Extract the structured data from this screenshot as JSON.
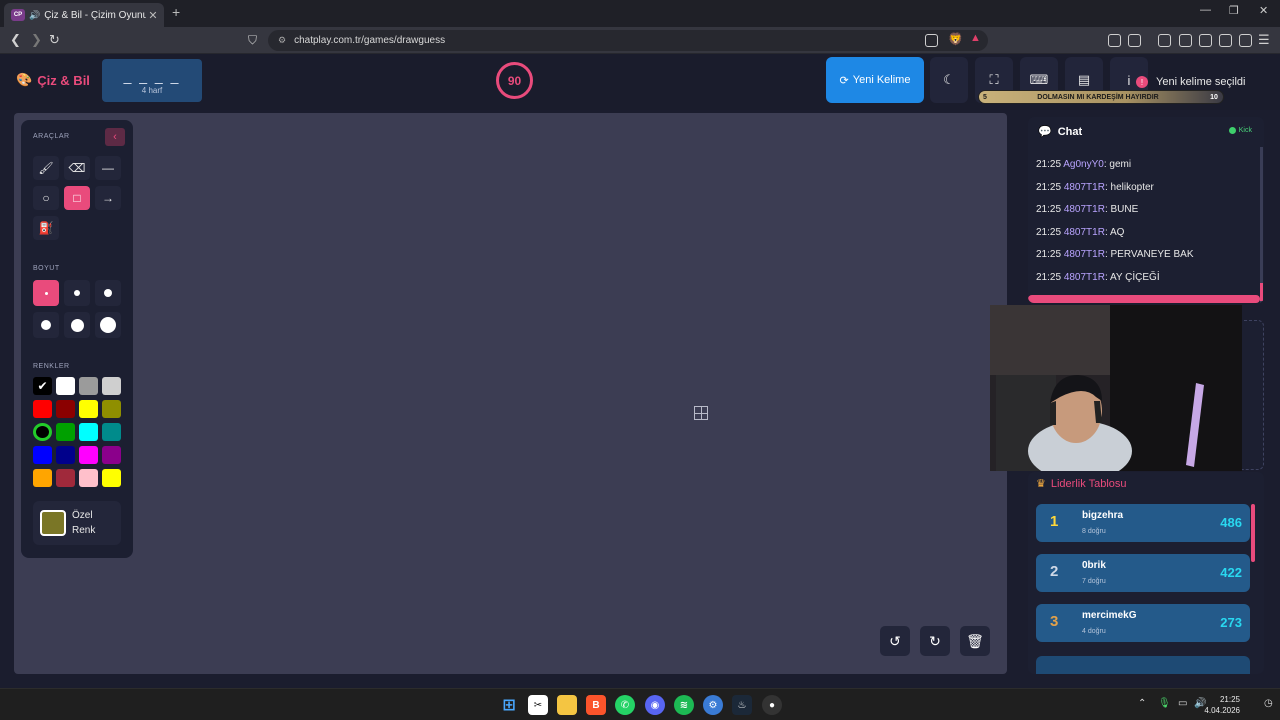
{
  "browser": {
    "tab_title": "Çiz & Bil - Çizim Oyunu",
    "tab_favicon": "CP",
    "url": "chatplay.com.tr/games/drawguess"
  },
  "header": {
    "logo": "Çiz & Bil",
    "word_mask": "_ _ _ _",
    "word_length": "4 harf",
    "timer": "90",
    "new_word_button": "Yeni Kelime",
    "toast": "Yeni kelime seçildi",
    "goal_bar": {
      "min": "5",
      "text": "DOLMASIN MI KARDEŞİM HAYIRDIR",
      "max": "10"
    }
  },
  "tools": {
    "tools_title": "ARAÇLAR",
    "size_title": "BOYUT",
    "colors_title": "RENKLER",
    "custom_color": "Özel Renk",
    "colors": [
      "#000000",
      "#ffffff",
      "#9b9b9b",
      "#cfcfcf",
      "#ff0000",
      "#8b0000",
      "#ffff00",
      "#8f8f00",
      "#000000",
      "#00a000",
      "#00ffff",
      "#008b8b",
      "#0000ff",
      "#00008b",
      "#ff00ff",
      "#8b008b",
      "#ffa500",
      "#a0293b",
      "#ffc0cb",
      "#ffff00"
    ],
    "custom_swatch": "#7a7626"
  },
  "chat": {
    "title": "Chat",
    "status": "Kick",
    "messages": [
      {
        "time": "21:25",
        "user": "Ag0nyY0",
        "text": ": gemi"
      },
      {
        "time": "21:25",
        "user": "4807T1R",
        "text": ": helikopter"
      },
      {
        "time": "21:25",
        "user": "4807T1R",
        "text": ": BUNE"
      },
      {
        "time": "21:25",
        "user": "4807T1R",
        "text": ": AQ"
      },
      {
        "time": "21:25",
        "user": "4807T1R",
        "text": ": PERVANEYE BAK"
      },
      {
        "time": "21:25",
        "user": "4807T1R",
        "text": ": AY ÇİÇEĞİ"
      }
    ]
  },
  "leaderboard": {
    "title": "Liderlik Tablosu",
    "rows": [
      {
        "rank": "1",
        "name": "bigzehra",
        "correct": "8 doğru",
        "score": "486",
        "rank_color": "#ffd83a"
      },
      {
        "rank": "2",
        "name": "0brik",
        "correct": "7 doğru",
        "score": "422",
        "rank_color": "#cfd8e6"
      },
      {
        "rank": "3",
        "name": "mercimekG",
        "correct": "4 doğru",
        "score": "273",
        "rank_color": "#e2a14a"
      }
    ]
  },
  "taskbar": {
    "time": "21:25",
    "date": "4.04.2026"
  }
}
